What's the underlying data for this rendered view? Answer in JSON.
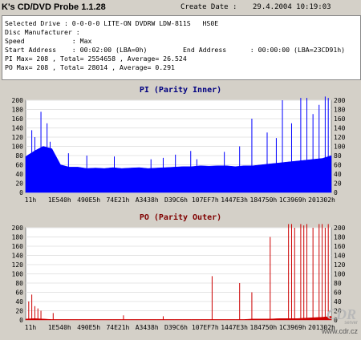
{
  "window": {
    "title": "K's CD/DVD Probe 1.1.28"
  },
  "header": {
    "create_label": "Create Date :",
    "create_value": "29.4.2004 10:19:03"
  },
  "info": {
    "selected_drive": "Selected Drive : 0-0-0-0 LITE-ON DVDRW LDW-811S   HS0E",
    "disc_manufacturer": "Disc Manufacturer :",
    "speed": "Speed            : Max",
    "start_address": "Start Address    : 00:02:00 (LBA=0h)",
    "end_address": "End Address      : 00:00:00 (LBA=23CD91h)",
    "pi_summary": "PI Max= 208 , Total= 2554658 , Average= 26.524",
    "po_summary": "PO Max= 208 , Total= 28014 , Average= 0.291"
  },
  "chart_data": [
    {
      "type": "bar",
      "title": "PI (Parity Inner)",
      "ylim": [
        0,
        200
      ],
      "y_ticks": [
        "0",
        "20",
        "40",
        "60",
        "80",
        "100",
        "120",
        "140",
        "160",
        "180",
        "200"
      ],
      "x_ticks": [
        "11h",
        "1E540h",
        "490E5h",
        "74E21h",
        "A3438h",
        "D39C6h",
        "107EF7h",
        "1447E3h",
        "184750h",
        "1C3969h",
        "201302h"
      ],
      "color": "#0000ff",
      "baseline": [
        78,
        90,
        100,
        95,
        60,
        55,
        55,
        52,
        53,
        52,
        54,
        52,
        53,
        54,
        52,
        53,
        54,
        55,
        56,
        56,
        58,
        57,
        58,
        58,
        56,
        58,
        58,
        60,
        62,
        64,
        66,
        68,
        70,
        72,
        74,
        80
      ],
      "spikes": [
        [
          0.02,
          135
        ],
        [
          0.03,
          120
        ],
        [
          0.05,
          175
        ],
        [
          0.07,
          150
        ],
        [
          0.08,
          110
        ],
        [
          0.14,
          85
        ],
        [
          0.2,
          80
        ],
        [
          0.29,
          78
        ],
        [
          0.41,
          72
        ],
        [
          0.45,
          75
        ],
        [
          0.49,
          82
        ],
        [
          0.54,
          90
        ],
        [
          0.56,
          72
        ],
        [
          0.65,
          88
        ],
        [
          0.7,
          100
        ],
        [
          0.74,
          160
        ],
        [
          0.79,
          130
        ],
        [
          0.82,
          118
        ],
        [
          0.84,
          200
        ],
        [
          0.87,
          150
        ],
        [
          0.9,
          205
        ],
        [
          0.92,
          205
        ],
        [
          0.94,
          170
        ],
        [
          0.96,
          190
        ],
        [
          0.98,
          208
        ],
        [
          0.99,
          205
        ]
      ]
    },
    {
      "type": "bar",
      "title": "PO (Parity Outer)",
      "ylim": [
        0,
        200
      ],
      "y_ticks": [
        "0",
        "20",
        "40",
        "60",
        "80",
        "100",
        "120",
        "140",
        "160",
        "180",
        "200"
      ],
      "x_ticks": [
        "11h",
        "1E540h",
        "490E5h",
        "74E21h",
        "A3438h",
        "D39C6h",
        "107EF7h",
        "1447E3h",
        "184750h",
        "1C3969h",
        "201302h"
      ],
      "color": "#cc0000",
      "baseline": [
        2,
        3,
        2,
        1,
        1,
        1,
        1,
        1,
        1,
        1,
        1,
        1,
        1,
        1,
        1,
        1,
        1,
        1,
        1,
        1,
        1,
        1,
        1,
        1,
        1,
        1,
        2,
        2,
        2,
        3,
        3,
        3,
        4,
        5,
        6,
        8
      ],
      "spikes": [
        [
          0.01,
          40
        ],
        [
          0.02,
          55
        ],
        [
          0.03,
          30
        ],
        [
          0.04,
          25
        ],
        [
          0.05,
          20
        ],
        [
          0.09,
          15
        ],
        [
          0.32,
          10
        ],
        [
          0.45,
          8
        ],
        [
          0.61,
          95
        ],
        [
          0.7,
          80
        ],
        [
          0.74,
          60
        ],
        [
          0.8,
          180
        ],
        [
          0.86,
          210
        ],
        [
          0.87,
          210
        ],
        [
          0.88,
          200
        ],
        [
          0.9,
          210
        ],
        [
          0.91,
          205
        ],
        [
          0.92,
          210
        ],
        [
          0.94,
          200
        ],
        [
          0.96,
          210
        ],
        [
          0.97,
          210
        ],
        [
          0.98,
          200
        ],
        [
          0.99,
          210
        ]
      ]
    }
  ],
  "watermark": {
    "text": "www.cdr.cz",
    "brand": "CDR",
    "sub": "server"
  }
}
